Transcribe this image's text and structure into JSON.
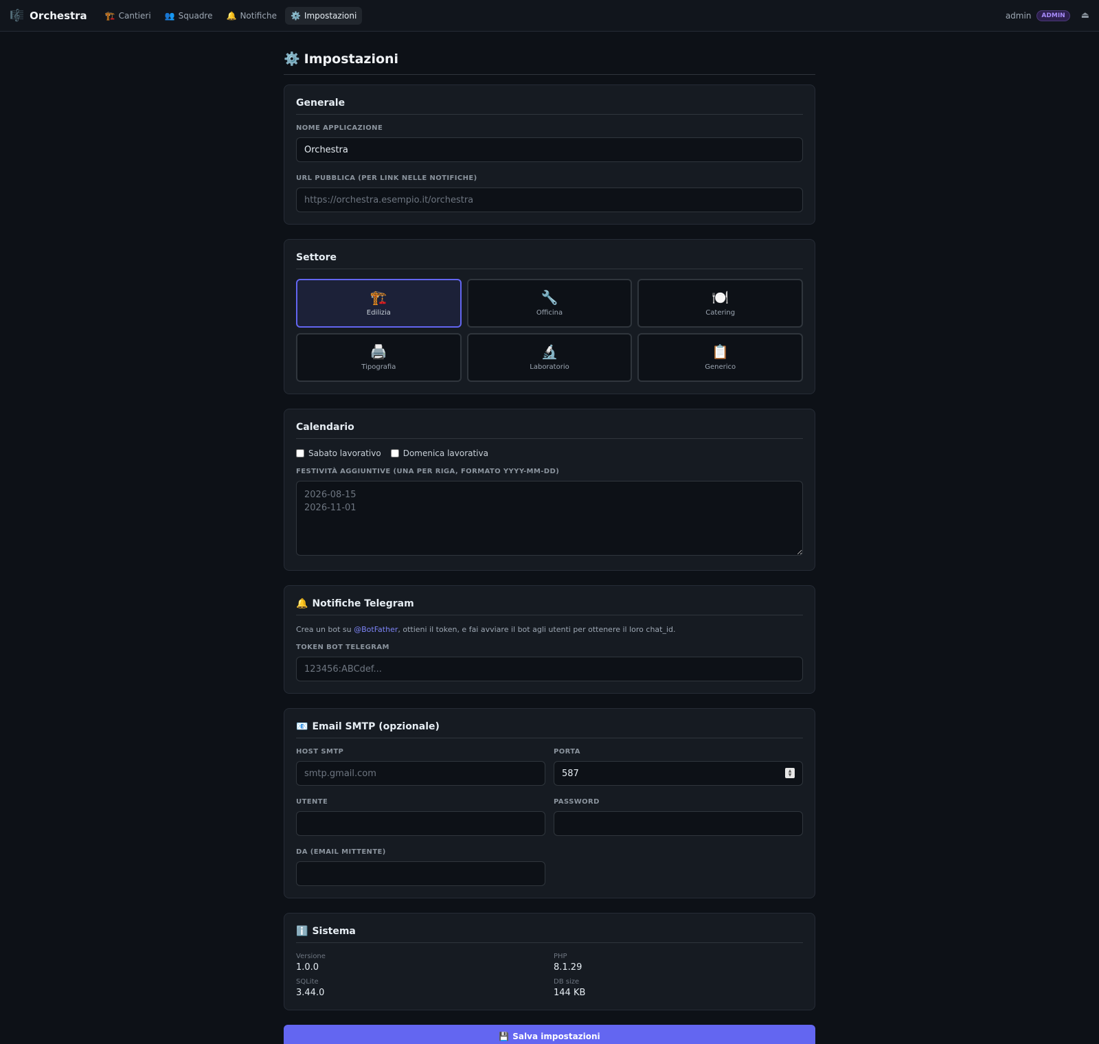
{
  "app": {
    "name": "Orchestra",
    "icon": "🎼"
  },
  "nav": {
    "items": [
      {
        "icon": "🏗️",
        "label": "Cantieri"
      },
      {
        "icon": "👥",
        "label": "Squadre"
      },
      {
        "icon": "🔔",
        "label": "Notifiche"
      },
      {
        "icon": "⚙️",
        "label": "Impostazioni"
      }
    ]
  },
  "user": {
    "name": "admin",
    "role": "ADMIN",
    "logout_icon": "⏏"
  },
  "page": {
    "icon": "⚙️",
    "title": "Impostazioni"
  },
  "generale": {
    "title": "Generale",
    "app_name_label": "Nome applicazione",
    "app_name_value": "Orchestra",
    "url_label": "URL pubblica (per link nelle notifiche)",
    "url_placeholder": "https://orchestra.esempio.it/orchestra"
  },
  "settore": {
    "title": "Settore",
    "options": [
      {
        "icon": "🏗️",
        "label": "Edilizia",
        "selected": true
      },
      {
        "icon": "🔧",
        "label": "Officina",
        "selected": false
      },
      {
        "icon": "🍽️",
        "label": "Catering",
        "selected": false
      },
      {
        "icon": "🖨️",
        "label": "Tipografia",
        "selected": false
      },
      {
        "icon": "🔬",
        "label": "Laboratorio",
        "selected": false
      },
      {
        "icon": "📋",
        "label": "Generico",
        "selected": false
      }
    ]
  },
  "calendario": {
    "title": "Calendario",
    "sabato_label": "Sabato lavorativo",
    "domenica_label": "Domenica lavorativa",
    "festivita_label": "Festività aggiuntive (una per riga, formato YYYY-MM-DD)",
    "festivita_placeholder": "2026-08-15\n2026-11-01"
  },
  "telegram": {
    "icon": "🔔",
    "title": "Notifiche Telegram",
    "help_prefix": "Crea un bot su ",
    "help_link": "@BotFather",
    "help_suffix": ", ottieni il token, e fai avviare il bot agli utenti per ottenere il loro chat_id.",
    "token_label": "Token Bot Telegram",
    "token_placeholder": "123456:ABCdef..."
  },
  "smtp": {
    "icon": "📧",
    "title": "Email SMTP (opzionale)",
    "host_label": "Host SMTP",
    "host_placeholder": "smtp.gmail.com",
    "port_label": "Porta",
    "port_value": "587",
    "user_label": "Utente",
    "password_label": "Password",
    "from_label": "Da (email mittente)"
  },
  "sistema": {
    "icon": "ℹ️",
    "title": "Sistema",
    "items": [
      {
        "label": "Versione",
        "value": "1.0.0"
      },
      {
        "label": "PHP",
        "value": "8.1.29"
      },
      {
        "label": "SQLite",
        "value": "3.44.0"
      },
      {
        "label": "DB size",
        "value": "144 KB"
      }
    ]
  },
  "save": {
    "icon": "💾",
    "label": "Salva impostazioni"
  }
}
